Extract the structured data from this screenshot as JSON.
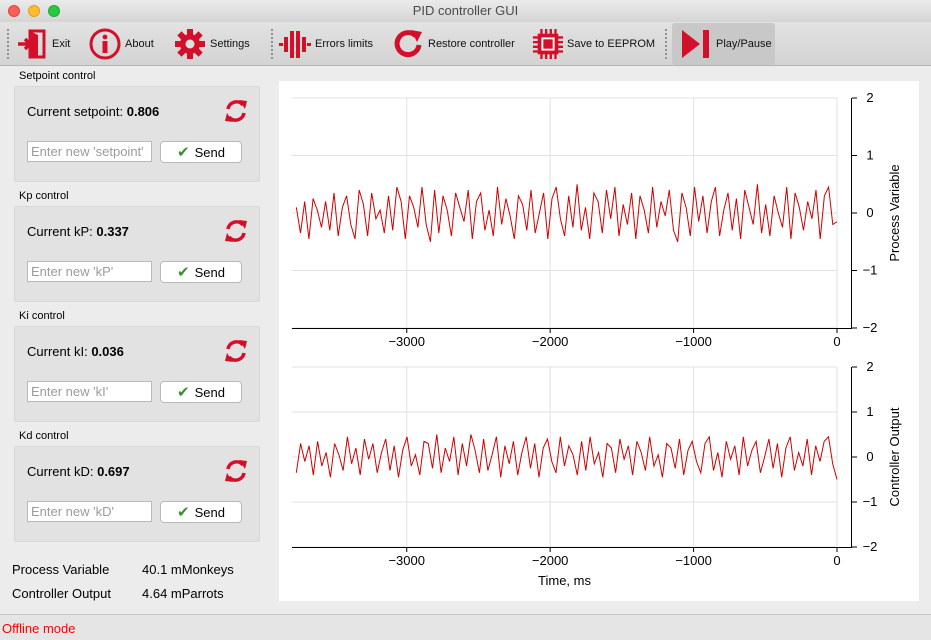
{
  "window": {
    "title": "PID controller GUI"
  },
  "toolbar": {
    "exit": "Exit",
    "about": "About",
    "settings": "Settings",
    "errors_limits": "Errors limits",
    "restore": "Restore controller",
    "eeprom": "Save to EEPROM",
    "play_pause": "Play/Pause"
  },
  "controls": [
    {
      "group": "Setpoint control",
      "label": "Current setpoint:",
      "value": "0.806",
      "placeholder": "Enter new 'setpoint'",
      "send": "Send"
    },
    {
      "group": "Kp control",
      "label": "Current kP:",
      "value": "0.337",
      "placeholder": "Enter new 'kP'",
      "send": "Send"
    },
    {
      "group": "Ki control",
      "label": "Current kI:",
      "value": "0.036",
      "placeholder": "Enter new 'kI'",
      "send": "Send"
    },
    {
      "group": "Kd control",
      "label": "Current kD:",
      "value": "0.697",
      "placeholder": "Enter new 'kD'",
      "send": "Send"
    }
  ],
  "readouts": {
    "pv_label": "Process Variable",
    "pv_value": "40.1 mMonkeys",
    "co_label": "Controller Output",
    "co_value": "4.64 mParrots"
  },
  "status": {
    "text": "Offline mode"
  },
  "colors": {
    "accent": "#d40f2a",
    "trace": "#d00000",
    "status": "#ff0000",
    "check": "#3d8c2f"
  },
  "chart_data": [
    {
      "type": "line",
      "ylabel": "Process Variable",
      "xlabel": "",
      "xlim": [
        -3800,
        0
      ],
      "ylim": [
        -2,
        2
      ],
      "xticks": [
        -3000,
        -2000,
        -1000,
        0
      ],
      "yticks": [
        2,
        1,
        0,
        -1,
        -2
      ],
      "grid": true,
      "series": [
        {
          "values": [
            0.1,
            -0.35,
            0.2,
            -0.45,
            0.25,
            0.05,
            -0.25,
            0.2,
            -0.3,
            0.35,
            -0.4,
            0.1,
            0.3,
            -0.2,
            -0.45,
            0.4,
            0.15,
            -0.4,
            0.35,
            -0.1,
            0.05,
            -0.35,
            0.3,
            -0.3,
            0.45,
            0.2,
            -0.45,
            0.3,
            0.1,
            -0.25,
            0.45,
            -0.2,
            -0.5,
            0.4,
            -0.35,
            0.3,
            0.05,
            -0.4,
            0.35,
            0.1,
            -0.15,
            0.4,
            -0.45,
            0.2,
            0.35,
            -0.3,
            0.05,
            -0.4,
            0.45,
            -0.2,
            0.25,
            -0.05,
            -0.45,
            0.3,
            0.15,
            -0.3,
            0.4,
            -0.35,
            0.0,
            0.35,
            -0.45,
            0.25,
            0.45,
            -0.1,
            -0.4,
            0.3,
            -0.25,
            0.5,
            -0.3,
            0.1,
            -0.45,
            0.35,
            0.2,
            -0.35,
            0.4,
            -0.1,
            0.45,
            -0.4,
            0.15,
            -0.2,
            0.35,
            -0.45,
            0.3,
            0.05,
            -0.35,
            0.45,
            -0.25,
            0.2,
            -0.05,
            0.4,
            -0.3,
            -0.5,
            0.35,
            0.1,
            -0.4,
            0.45,
            -0.15,
            0.3,
            -0.35,
            0.2,
            0.45,
            -0.4,
            0.05,
            0.35,
            -0.3,
            0.25,
            -0.45,
            0.4,
            0.1,
            -0.2,
            0.5,
            -0.35,
            0.15,
            -0.4,
            0.3,
            0.0,
            -0.25,
            0.45,
            -0.45,
            0.35,
            0.1,
            -0.3,
            0.2,
            -0.1,
            0.4,
            -0.45,
            0.3,
            0.45,
            -0.2,
            -0.15
          ]
        }
      ]
    },
    {
      "type": "line",
      "ylabel": "Controller Output",
      "xlabel": "Time, ms",
      "xlim": [
        -3800,
        0
      ],
      "ylim": [
        -2,
        2
      ],
      "xticks": [
        -3000,
        -2000,
        -1000,
        0
      ],
      "yticks": [
        2,
        1,
        0,
        -1,
        -2
      ],
      "grid": true,
      "series": [
        {
          "values": [
            -0.35,
            0.3,
            -0.1,
            0.25,
            -0.4,
            0.35,
            -0.2,
            0.1,
            -0.45,
            0.3,
            0.05,
            -0.3,
            0.45,
            -0.15,
            0.2,
            -0.4,
            0.4,
            -0.05,
            0.3,
            -0.35,
            0.1,
            0.4,
            -0.3,
            0.25,
            -0.45,
            0.15,
            0.45,
            -0.2,
            0.05,
            -0.4,
            0.35,
            0.3,
            -0.25,
            0.5,
            -0.35,
            0.2,
            -0.1,
            0.45,
            -0.4,
            0.3,
            -0.2,
            0.5,
            0.15,
            -0.35,
            0.4,
            -0.3,
            0.05,
            0.45,
            -0.45,
            0.25,
            -0.15,
            0.35,
            -0.4,
            0.1,
            0.45,
            -0.25,
            0.3,
            -0.45,
            0.2,
            0.4,
            -0.1,
            -0.35,
            0.45,
            -0.2,
            0.25,
            0.05,
            -0.4,
            0.35,
            -0.3,
            0.45,
            -0.15,
            0.1,
            -0.45,
            0.3,
            0.2,
            -0.35,
            0.4,
            -0.05,
            0.25,
            -0.4,
            0.35,
            0.1,
            -0.3,
            0.45,
            -0.2,
            0.05,
            -0.45,
            0.3,
            0.2,
            -0.25,
            0.4,
            -0.4,
            0.15,
            0.35,
            -0.1,
            -0.35,
            0.3,
            0.45,
            -0.3,
            0.1,
            -0.45,
            0.35,
            -0.05,
            0.25,
            -0.4,
            0.45,
            -0.2,
            0.15,
            0.35,
            -0.35,
            0.0,
            0.4,
            -0.25,
            0.3,
            -0.45,
            0.2,
            0.45,
            -0.3,
            0.1,
            -0.2,
            0.4,
            -0.4,
            0.25,
            -0.1,
            0.35,
            0.45,
            -0.15,
            -0.5
          ]
        }
      ]
    }
  ]
}
